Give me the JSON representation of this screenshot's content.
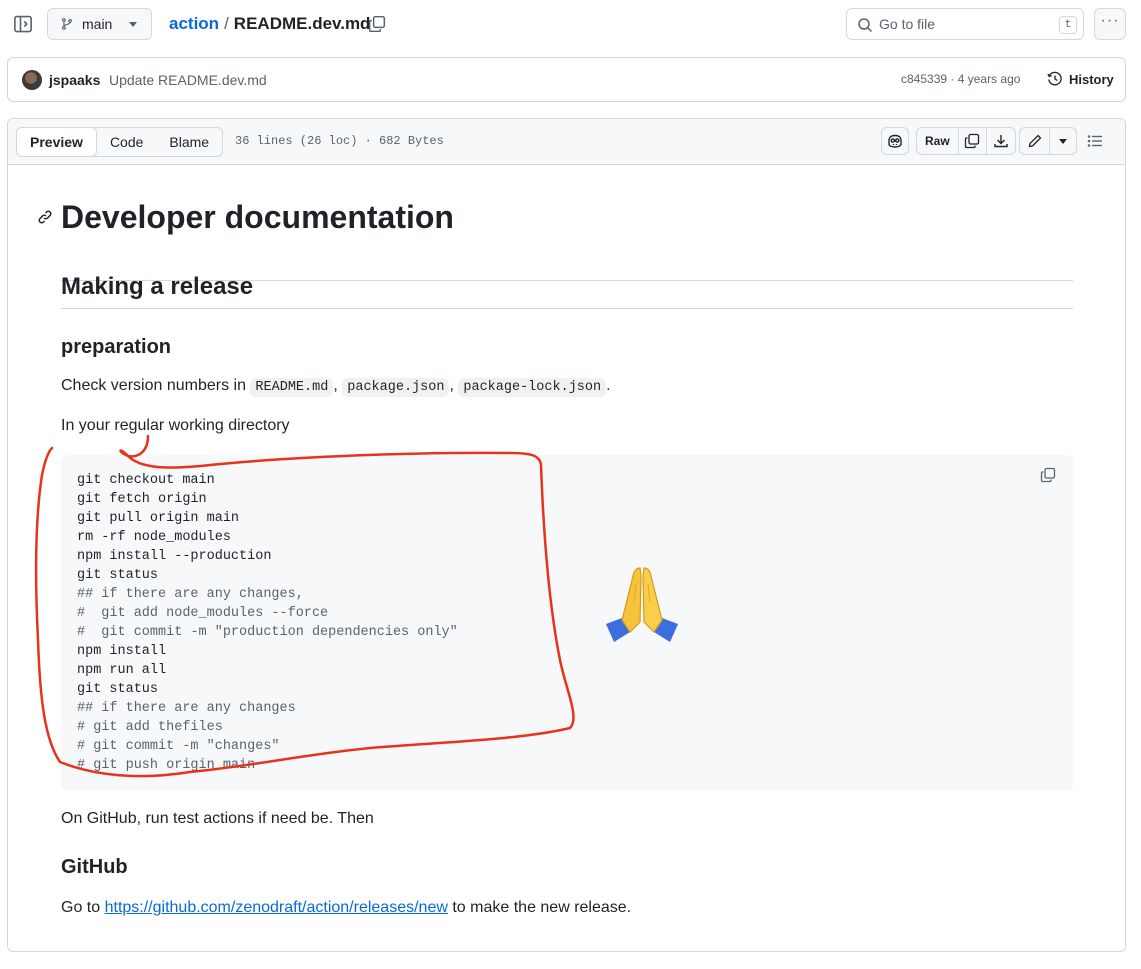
{
  "topbar": {
    "branch": "main",
    "repo": "action",
    "separator": "/",
    "file": "README.dev.md",
    "goto_placeholder": "Go to file",
    "goto_shortcut": "t",
    "more": "···"
  },
  "commit": {
    "author": "jspaaks",
    "message": "Update README.dev.md",
    "meta": "c845339 · 4 years ago",
    "history_label": "History"
  },
  "file_header": {
    "tabs": [
      "Preview",
      "Code",
      "Blame"
    ],
    "info": "36 lines (26 loc) · 682 Bytes",
    "raw_label": "Raw"
  },
  "doc": {
    "h1": "Developer documentation",
    "h2": "Making a release",
    "h3_preparation": "preparation",
    "p_versions_prefix": "Check version numbers in",
    "code_readme": "README.md",
    "code_package": "package.json",
    "code_lock": "package-lock.json",
    "comma": ",",
    "period": ".",
    "p_working_dir": "In your regular working directory",
    "code_lines": [
      {
        "text": "git checkout main",
        "comment": false
      },
      {
        "text": "git fetch origin",
        "comment": false
      },
      {
        "text": "git pull origin main",
        "comment": false
      },
      {
        "text": "rm -rf node_modules",
        "comment": false
      },
      {
        "text": "npm install --production",
        "comment": false
      },
      {
        "text": "git status",
        "comment": false
      },
      {
        "text": "## if there are any changes,",
        "comment": true
      },
      {
        "text": "#  git add node_modules --force",
        "comment": true
      },
      {
        "text": "#  git commit -m \"production dependencies only\"",
        "comment": true
      },
      {
        "text": "npm install",
        "comment": false
      },
      {
        "text": "npm run all",
        "comment": false
      },
      {
        "text": "git status",
        "comment": false
      },
      {
        "text": "## if there are any changes",
        "comment": true
      },
      {
        "text": "# git add thefiles",
        "comment": true
      },
      {
        "text": "# git commit -m \"changes\"",
        "comment": true
      },
      {
        "text": "# git push origin main",
        "comment": true
      }
    ],
    "p_github_run": "On GitHub, run test actions if need be. Then",
    "h3_github": "GitHub",
    "p_goto_prefix": "Go to",
    "link": "https://github.com/zenodraft/action/releases/new",
    "p_goto_suffix": "to make the new release."
  },
  "colors": {
    "link": "#0969da",
    "annotation": "#e8331c",
    "border": "#d1d9e0",
    "code_bg": "#f6f8fa"
  },
  "icons": [
    "sidebar-toggle-icon",
    "git-branch-icon",
    "copy-icon",
    "search-icon",
    "clock-history-icon",
    "copilot-icon",
    "download-icon",
    "pencil-icon",
    "list-unordered-icon",
    "link-icon",
    "folded-hands-emoji"
  ]
}
